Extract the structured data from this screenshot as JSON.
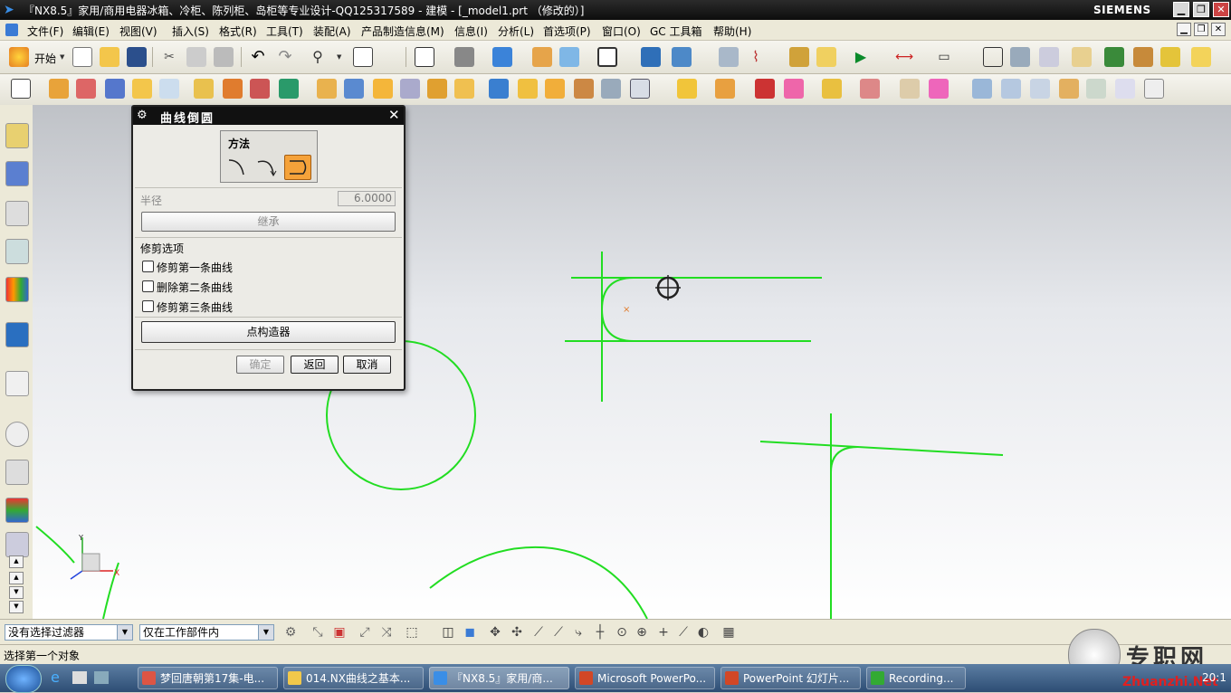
{
  "window": {
    "title": "『NX8.5』家用/商用电器冰箱、冷柜、陈列柜、岛柜等专业设计-QQ125317589 - 建模 - [_model1.prt （修改的）]",
    "brand": "SIEMENS"
  },
  "menu": [
    "文件(F)",
    "编辑(E)",
    "视图(V)",
    "插入(S)",
    "格式(R)",
    "工具(T)",
    "装配(A)",
    "产品制造信息(M)",
    "信息(I)",
    "分析(L)",
    "首选项(P)",
    "窗口(O)",
    "GC 工具箱",
    "帮助(H)"
  ],
  "toolbar": {
    "start_label": "开始"
  },
  "dialog": {
    "title": "曲线倒圆",
    "method_label": "方法",
    "radius_label": "半径",
    "radius_value": "6.0000",
    "inherit_label": "继承",
    "trim_options_label": "修剪选项",
    "options": [
      "修剪第一条曲线",
      "删除第二条曲线",
      "修剪第三条曲线"
    ],
    "point_constructor_label": "点构造器",
    "ok_label": "确定",
    "back_label": "返回",
    "cancel_label": "取消"
  },
  "selection": {
    "filter_value": "没有选择过滤器",
    "scope_value": "仅在工作部件内"
  },
  "status": {
    "prompt": "选择第一个对象"
  },
  "axes": {
    "y": "Y",
    "x": "X"
  },
  "taskbar": {
    "items": [
      "梦回唐朝第17集-电...",
      "014.NX曲线之基本...",
      "『NX8.5』家用/商...",
      "Microsoft PowerPo...",
      "PowerPoint 幻灯片...",
      "Recording..."
    ],
    "clock": "20:1"
  },
  "watermark": {
    "brand": "专职网",
    "url": "Zhuanzhi.Net"
  },
  "colors": {
    "curve": "#22dd22",
    "titlebar": "#111111",
    "highlight": "#f5a23a"
  }
}
